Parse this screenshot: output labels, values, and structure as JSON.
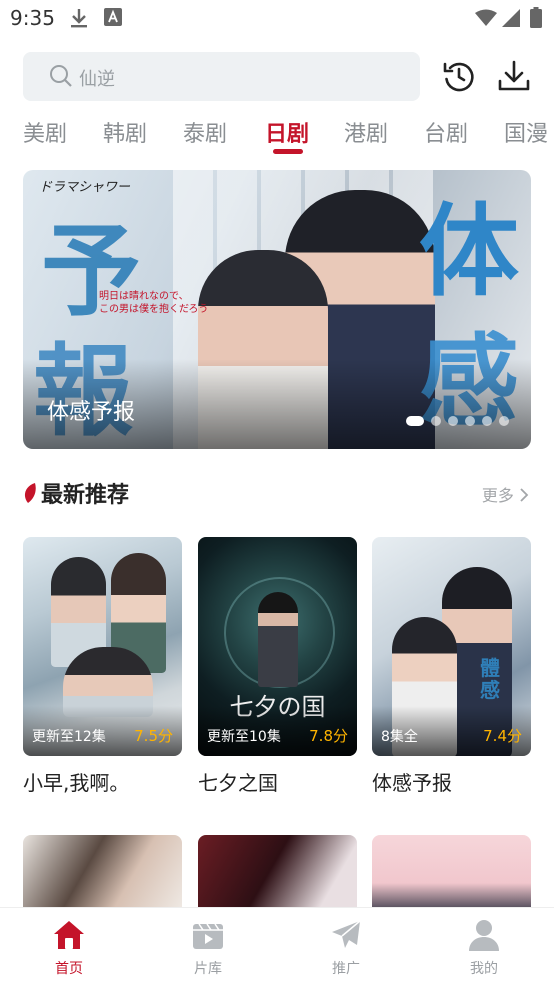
{
  "status_bar": {
    "time": "9:35"
  },
  "search": {
    "placeholder": "仙逆"
  },
  "category_tabs": [
    {
      "label": "美剧",
      "active": false
    },
    {
      "label": "韩剧",
      "active": false
    },
    {
      "label": "泰剧",
      "active": false
    },
    {
      "label": "日剧",
      "active": true
    },
    {
      "label": "港剧",
      "active": false
    },
    {
      "label": "台剧",
      "active": false
    },
    {
      "label": "国漫",
      "active": false
    }
  ],
  "banner": {
    "title": "体感予报",
    "logo_text": "ドラマシャワー",
    "tagline_line1": "明日は晴れなので、",
    "tagline_line2": "この男は僕を抱くだろう",
    "big_chars": [
      "予",
      "報",
      "体",
      "感"
    ],
    "slide_count": 6,
    "active_slide": 1
  },
  "section": {
    "title": "最新推荐",
    "more_label": "更多"
  },
  "recommendations": [
    {
      "title": "小早,我啊。",
      "episodes": "更新至12集",
      "score": "7.5分"
    },
    {
      "title": "七夕之国",
      "episodes": "更新至10集",
      "score": "7.8分",
      "poster_text": "七夕の国"
    },
    {
      "title": "体感予报",
      "episodes": "8集全",
      "score": "7.4分"
    }
  ],
  "bottom_nav": [
    {
      "label": "首页",
      "icon": "home-icon",
      "active": true
    },
    {
      "label": "片库",
      "icon": "film-library-icon",
      "active": false
    },
    {
      "label": "推广",
      "icon": "paper-plane-icon",
      "active": false
    },
    {
      "label": "我的",
      "icon": "user-icon",
      "active": false
    }
  ],
  "colors": {
    "accent": "#c4142a",
    "rating": "#ffb400",
    "muted_text": "#8a8e92"
  }
}
